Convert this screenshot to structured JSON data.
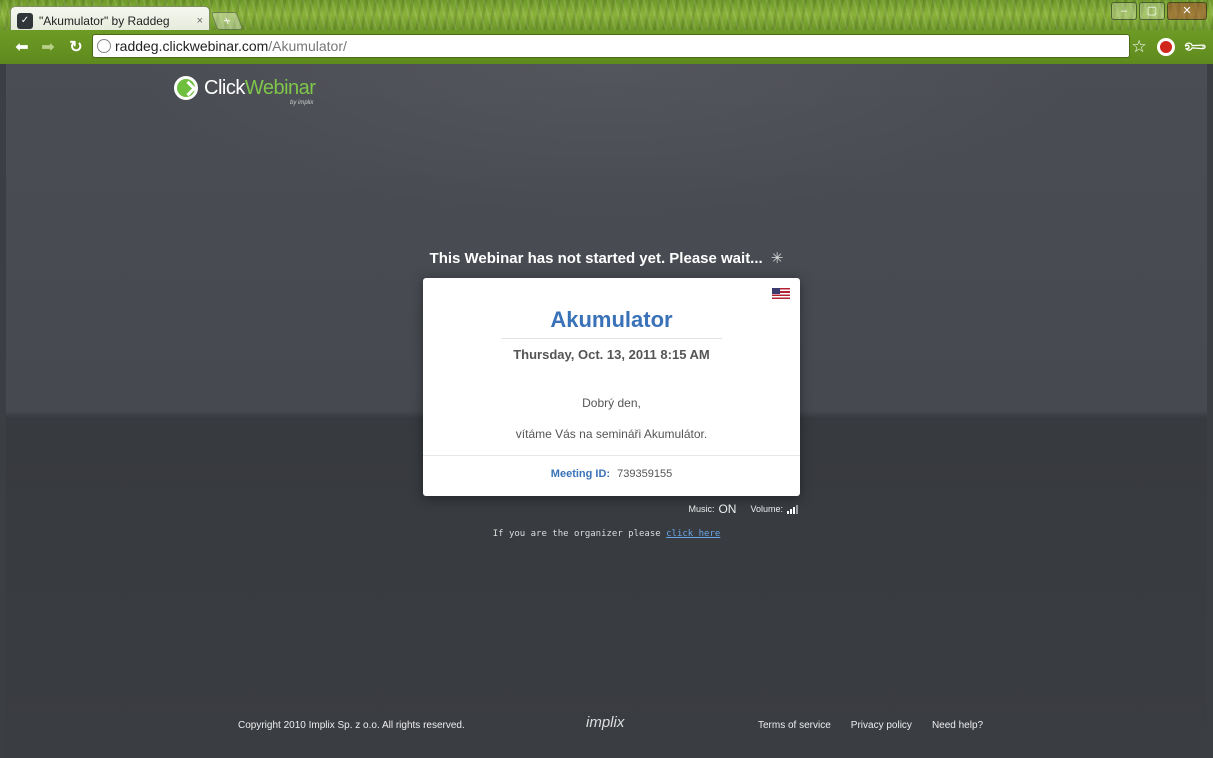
{
  "browser": {
    "tab_title": "\"Akumulator\" by Raddeg o",
    "tab_close": "×",
    "new_tab": "+",
    "url_host": "raddeg.clickwebinar.com",
    "url_path": "/Akumulator/",
    "window_controls": [
      "–",
      "▢",
      "✕"
    ]
  },
  "logo": {
    "text_plain": "Click",
    "text_accent": "Webinar",
    "sub": "by implix"
  },
  "status": {
    "wait_message": "This Webinar has not started yet. Please wait...",
    "spinner_glyph": "✳"
  },
  "webinar": {
    "title": "Akumulator",
    "datetime": "Thursday, Oct. 13, 2011 8:15 AM",
    "greeting": "Dobrý den,",
    "welcome": "vítáme Vás na semináři Akumulátor.",
    "meeting_label": "Meeting ID:",
    "meeting_id": "739359155",
    "language_flag": "us-flag-icon"
  },
  "audio": {
    "music_label": "Music:",
    "music_state": "ON",
    "volume_label": "Volume:"
  },
  "organizer": {
    "prompt": "If you are the organizer please",
    "link_text": "click here"
  },
  "footer": {
    "copyright": "Copyright  2010 Implix Sp. z o.o. All rights reserved.",
    "brand": "implix",
    "links": [
      "Terms of service",
      "Privacy policy",
      "Need help?"
    ]
  },
  "colors": {
    "accent_blue": "#3a72b8",
    "brand_green": "#7fc64a",
    "page_bg": "#46494f"
  }
}
